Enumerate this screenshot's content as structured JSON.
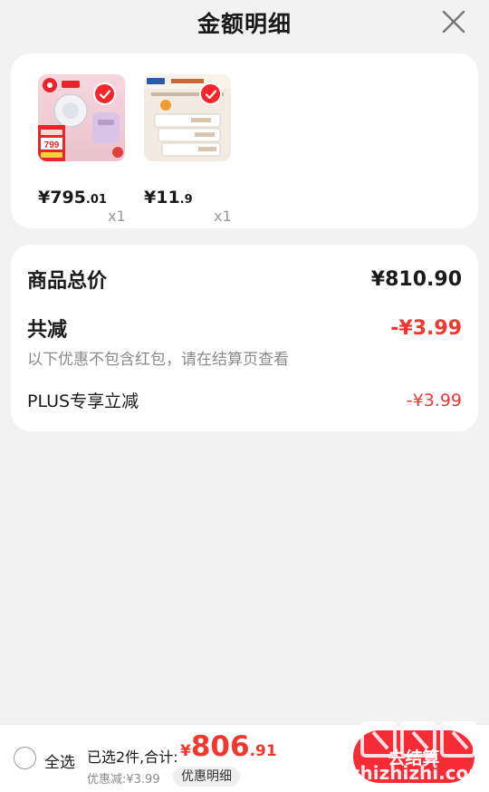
{
  "header": {
    "title": "金额明细"
  },
  "products": [
    {
      "price_main": "¥795",
      "price_cents": ".01",
      "qty": "x1",
      "badge": "限时下单 直降",
      "badge_price": "799"
    },
    {
      "price_main": "¥11",
      "price_cents": ".9",
      "qty": "x1",
      "banner": "柔软亲肤 婴儿专用"
    }
  ],
  "summary": {
    "total_label": "商品总价",
    "total_value": "¥810.90",
    "discount_label": "共减",
    "discount_value": "-¥3.99",
    "discount_note": "以下优惠不包含红包，请在结算页查看",
    "plus_label": "PLUS专享立减",
    "plus_value": "-¥3.99"
  },
  "footer": {
    "select_all": "全选",
    "selected_text": "已选2件,合计:",
    "total_symbol": "¥",
    "total_int": "806",
    "total_dec": ".91",
    "discount_text": "优惠减:¥3.99",
    "detail_button": "优惠明细",
    "checkout_button": "去结算"
  },
  "watermark": {
    "text": "值 什么值得买",
    "domain": "zhizhizhi.com"
  },
  "colors": {
    "accent": "#f0382f",
    "checkout": "#f52b35",
    "background": "#f2f2f2"
  }
}
